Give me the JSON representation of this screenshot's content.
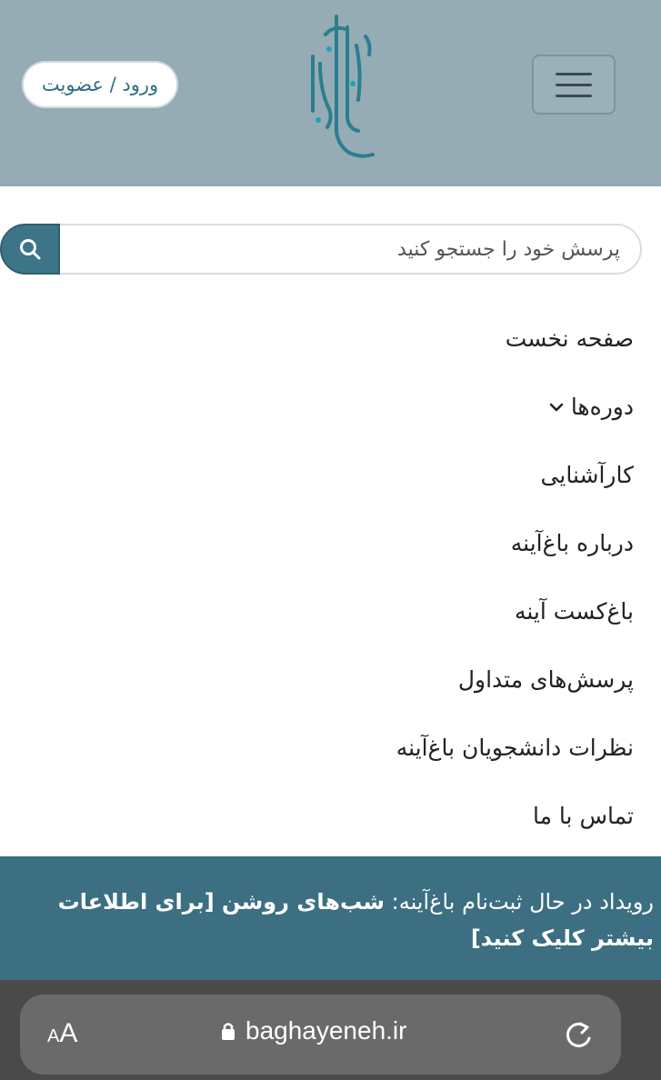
{
  "header": {
    "login_label": "ورود / عضویت",
    "brand_color": "#95acb5"
  },
  "search": {
    "placeholder": "پرسش خود را جستجو کنید"
  },
  "nav": {
    "items": [
      {
        "label": "صفحه نخست"
      },
      {
        "label": "دوره‌ها",
        "has_dropdown": true
      },
      {
        "label": "کارآشنایی"
      },
      {
        "label": "درباره باغ‌آینه"
      },
      {
        "label": "باغ‌کست آینه"
      },
      {
        "label": "پرسش‌های متداول"
      },
      {
        "label": "نظرات دانشجویان باغ‌آینه"
      },
      {
        "label": "تماس با ما"
      }
    ]
  },
  "banner": {
    "prefix": "رویداد در حال ثبت‌نام باغ‌آینه: ",
    "event": "شب‌های روشن",
    "cta": " [برای اطلاعات بیشتر کلیک کنید]",
    "color": "#3b6f81"
  },
  "browser": {
    "aa_small": "A",
    "aa_big": "A",
    "url": "baghayeneh.ir"
  }
}
